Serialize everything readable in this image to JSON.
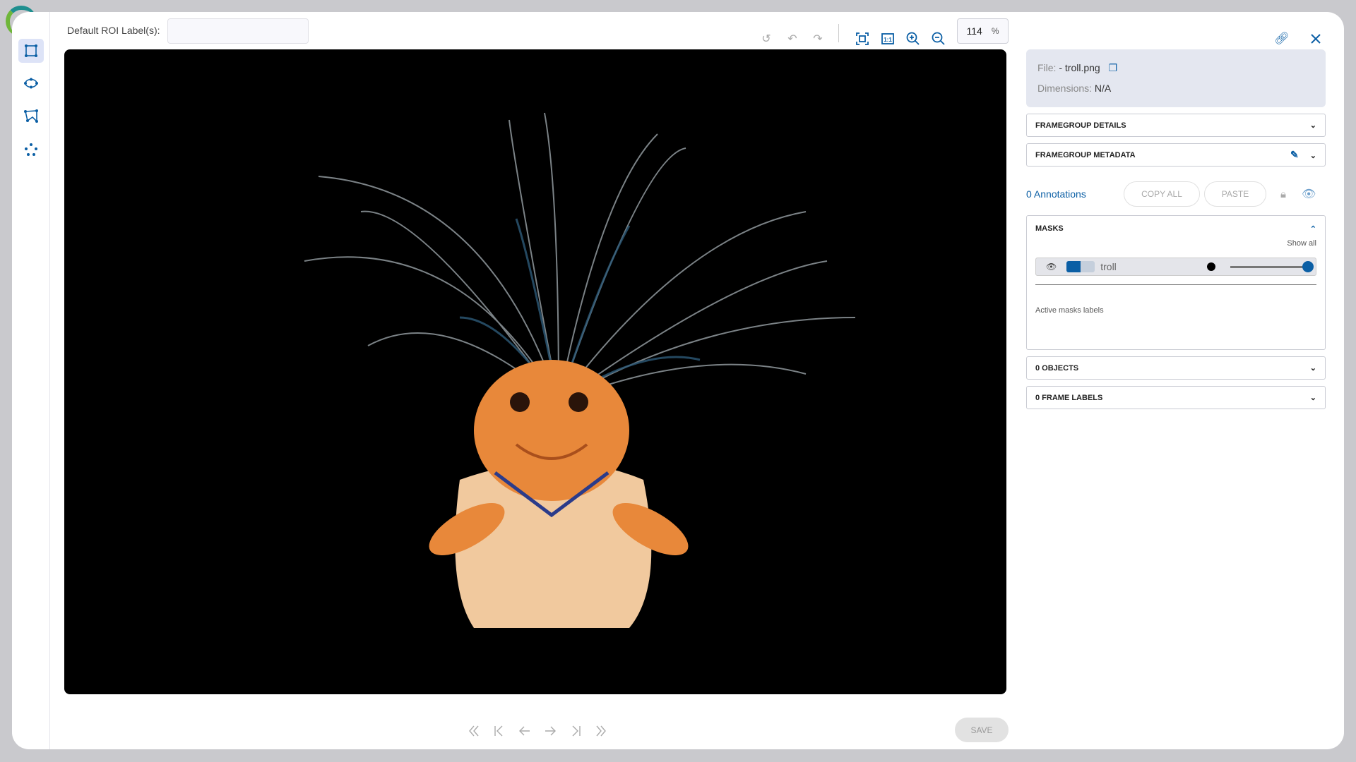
{
  "header": {
    "roi_label": "Default ROI Label(s):",
    "roi_value": "",
    "zoom_value": "114",
    "zoom_unit": "%"
  },
  "tools": [
    "rectangle-tool",
    "ellipse-tool",
    "polygon-tool",
    "points-tool"
  ],
  "file": {
    "file_label": "File:",
    "file_name": "- troll.png",
    "dimensions_label": "Dimensions:",
    "dimensions_value": "N/A"
  },
  "sections": {
    "details": "FRAMEGROUP DETAILS",
    "metadata": "FRAMEGROUP METADATA",
    "objects": "0 OBJECTS",
    "frame_labels": "0 FRAME LABELS"
  },
  "annotations": {
    "count_label": "0 Annotations",
    "copy_all": "COPY ALL",
    "paste": "PASTE"
  },
  "masks": {
    "title": "MASKS",
    "show_all": "Show all",
    "items": [
      {
        "name": "troll",
        "opacity": 1.0
      }
    ],
    "active_label": "Active masks labels"
  },
  "footer": {
    "save": "SAVE"
  },
  "colors": {
    "accent": "#0b5fa5",
    "canvas": "#000000"
  }
}
